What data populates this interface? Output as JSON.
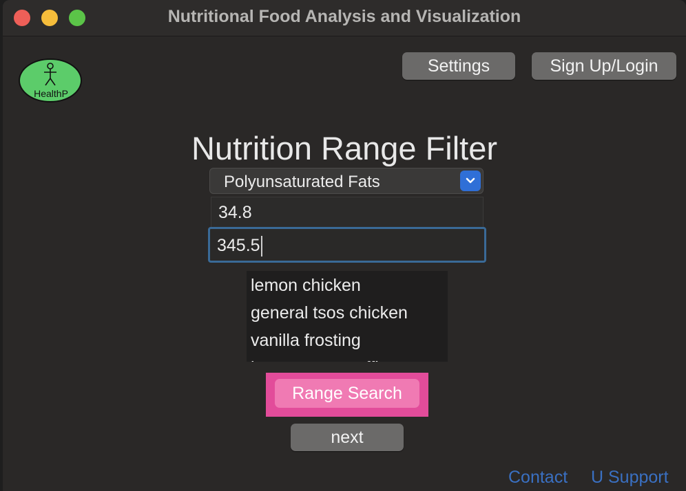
{
  "window": {
    "title": "Nutritional Food Analysis and Visualization"
  },
  "logo": {
    "text": "HealthP",
    "fill_color": "#5ccc6a"
  },
  "header": {
    "settings_label": "Settings",
    "signup_label": "Sign Up/Login"
  },
  "main": {
    "title": "Nutrition Range Filter",
    "nutrient_select": {
      "value": "Polyunsaturated Fats"
    },
    "min_input": {
      "value": "34.8"
    },
    "max_input": {
      "value": "345.5"
    },
    "results": [
      "lemon chicken",
      "general tsos chicken",
      "vanilla frosting",
      "banana nut muffin"
    ],
    "range_search_label": "Range Search",
    "next_label": "next"
  },
  "footer": {
    "contact_label": "Contact",
    "support_label": "U Support"
  },
  "colors": {
    "accent_blue": "#2f6fd7",
    "focus_ring": "#3a6a97",
    "highlight": "#e24c9a",
    "range_button": "#f07ab3",
    "link": "#3a70c2"
  }
}
